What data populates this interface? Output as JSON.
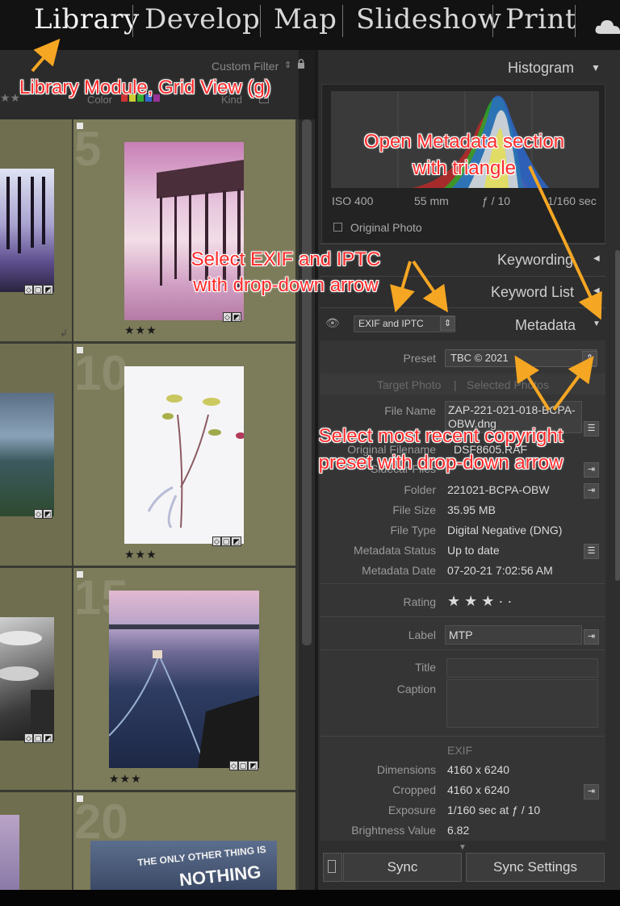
{
  "modules": [
    "Library",
    "Develop",
    "Map",
    "Slideshow",
    "Print"
  ],
  "grid": {
    "header": {
      "filter": "Custom Filter",
      "color_label": "Color",
      "kind_label": "Kind"
    },
    "cells": [
      {
        "number": "5",
        "stars": "★★★"
      },
      {
        "number": "10",
        "stars": "★★★"
      },
      {
        "number": "15",
        "stars": "★★★"
      },
      {
        "number": "20",
        "stars": ""
      }
    ],
    "photo_text": {
      "line1": "THE ONLY OTHER THING IS",
      "line2": "NOTHING"
    }
  },
  "histogram": {
    "title": "Histogram",
    "iso": "ISO 400",
    "focal": "55 mm",
    "aperture": "ƒ / 10",
    "shutter": "1/160 sec",
    "original": "Original Photo"
  },
  "panels": {
    "keywording": "Keywording",
    "keyword_list": "Keyword List",
    "metadata": "Metadata"
  },
  "metadata": {
    "view_select": "EXIF and IPTC",
    "preset_label": "Preset",
    "preset_value": "TBC © 2021",
    "target_photo": "Target Photo",
    "selected_photos": "Selected Photos",
    "rows": [
      {
        "label": "File Name",
        "value": "ZAP-221-021-018-BCPA-OBW.dng"
      },
      {
        "label": "Original Filename",
        "value": "DSF8605.RAF"
      },
      {
        "label": "Sidecar Files",
        "value": ""
      },
      {
        "label": "Folder",
        "value": "221021-BCPA-OBW"
      },
      {
        "label": "File Size",
        "value": "35.95 MB"
      },
      {
        "label": "File Type",
        "value": "Digital Negative (DNG)"
      },
      {
        "label": "Metadata Status",
        "value": "Up to date"
      },
      {
        "label": "Metadata Date",
        "value": "07-20-21 7:02:56 AM"
      }
    ],
    "rating_label": "Rating",
    "rating_value": "★ ★ ★ · ·",
    "label_label": "Label",
    "label_value": "MTP",
    "title_label": "Title",
    "caption_label": "Caption",
    "exif_header": "EXIF",
    "exif_rows": [
      {
        "label": "Dimensions",
        "value": "4160 x 6240"
      },
      {
        "label": "Cropped",
        "value": "4160 x 6240"
      },
      {
        "label": "Exposure",
        "value": "1/160 sec at ƒ / 10"
      },
      {
        "label": "Brightness Value",
        "value": "6.82"
      }
    ]
  },
  "buttons": {
    "sync": "Sync",
    "sync_settings": "Sync Settings"
  },
  "annotations": {
    "library": "Library Module, Grid View (g)",
    "metadata_1": "Open Metadata section",
    "metadata_2": "with triangle",
    "exif_1": "Select EXIF and IPTC",
    "exif_2": "with drop-down arrow",
    "preset_1": "Select most recent copyright",
    "preset_2": "preset with drop-down arrow"
  },
  "colors": {
    "annotation": "#ff2a2a",
    "arrow": "#f5a623",
    "cell": "#7c7b5a",
    "panel": "#2e2e2e"
  }
}
